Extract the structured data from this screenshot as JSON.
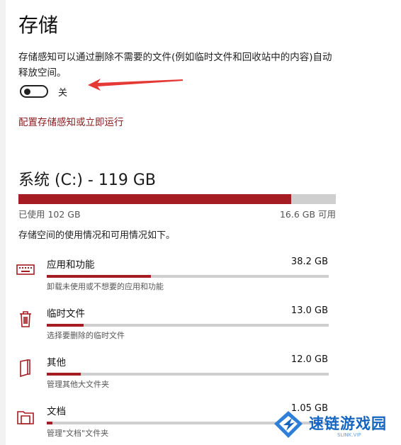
{
  "page": {
    "title": "存储",
    "description": "存储感知可以通过删除不需要的文件(例如临时文件和回收站中的内容)自动释放空间。",
    "toggle": {
      "state_label": "关",
      "on": false
    },
    "config_link": "配置存储感知或立即运行"
  },
  "drive": {
    "title": "系统 (C:) - 119 GB",
    "used_label": "已使用 102 GB",
    "free_label": "16.6 GB 可用",
    "used_fraction": 0.86,
    "summary": "存储空间的使用情况和可用情况如下。"
  },
  "categories": [
    {
      "name": "应用和功能",
      "size": "38.2 GB",
      "sub": "卸载未使用或不想要的应用和功能",
      "fraction": 0.37,
      "icon": "keyboard-icon"
    },
    {
      "name": "临时文件",
      "size": "13.0 GB",
      "sub": "选择要删除的临时文件",
      "fraction": 0.13,
      "icon": "trash-icon"
    },
    {
      "name": "其他",
      "size": "12.0 GB",
      "sub": "管理其他大文件夹",
      "fraction": 0.12,
      "icon": "folder-icon"
    },
    {
      "name": "文档",
      "size": "1.05 GB",
      "sub": "管理\"文档\"文件夹",
      "fraction": 0.02,
      "icon": "documents-icon"
    }
  ],
  "watermark": {
    "text": "速链游戏园",
    "sub": "SLINK.VIP"
  },
  "colors": {
    "accent": "#a51d22",
    "link": "#8b1d20",
    "arrow": "#e53935",
    "watermark": "#1565c0"
  }
}
